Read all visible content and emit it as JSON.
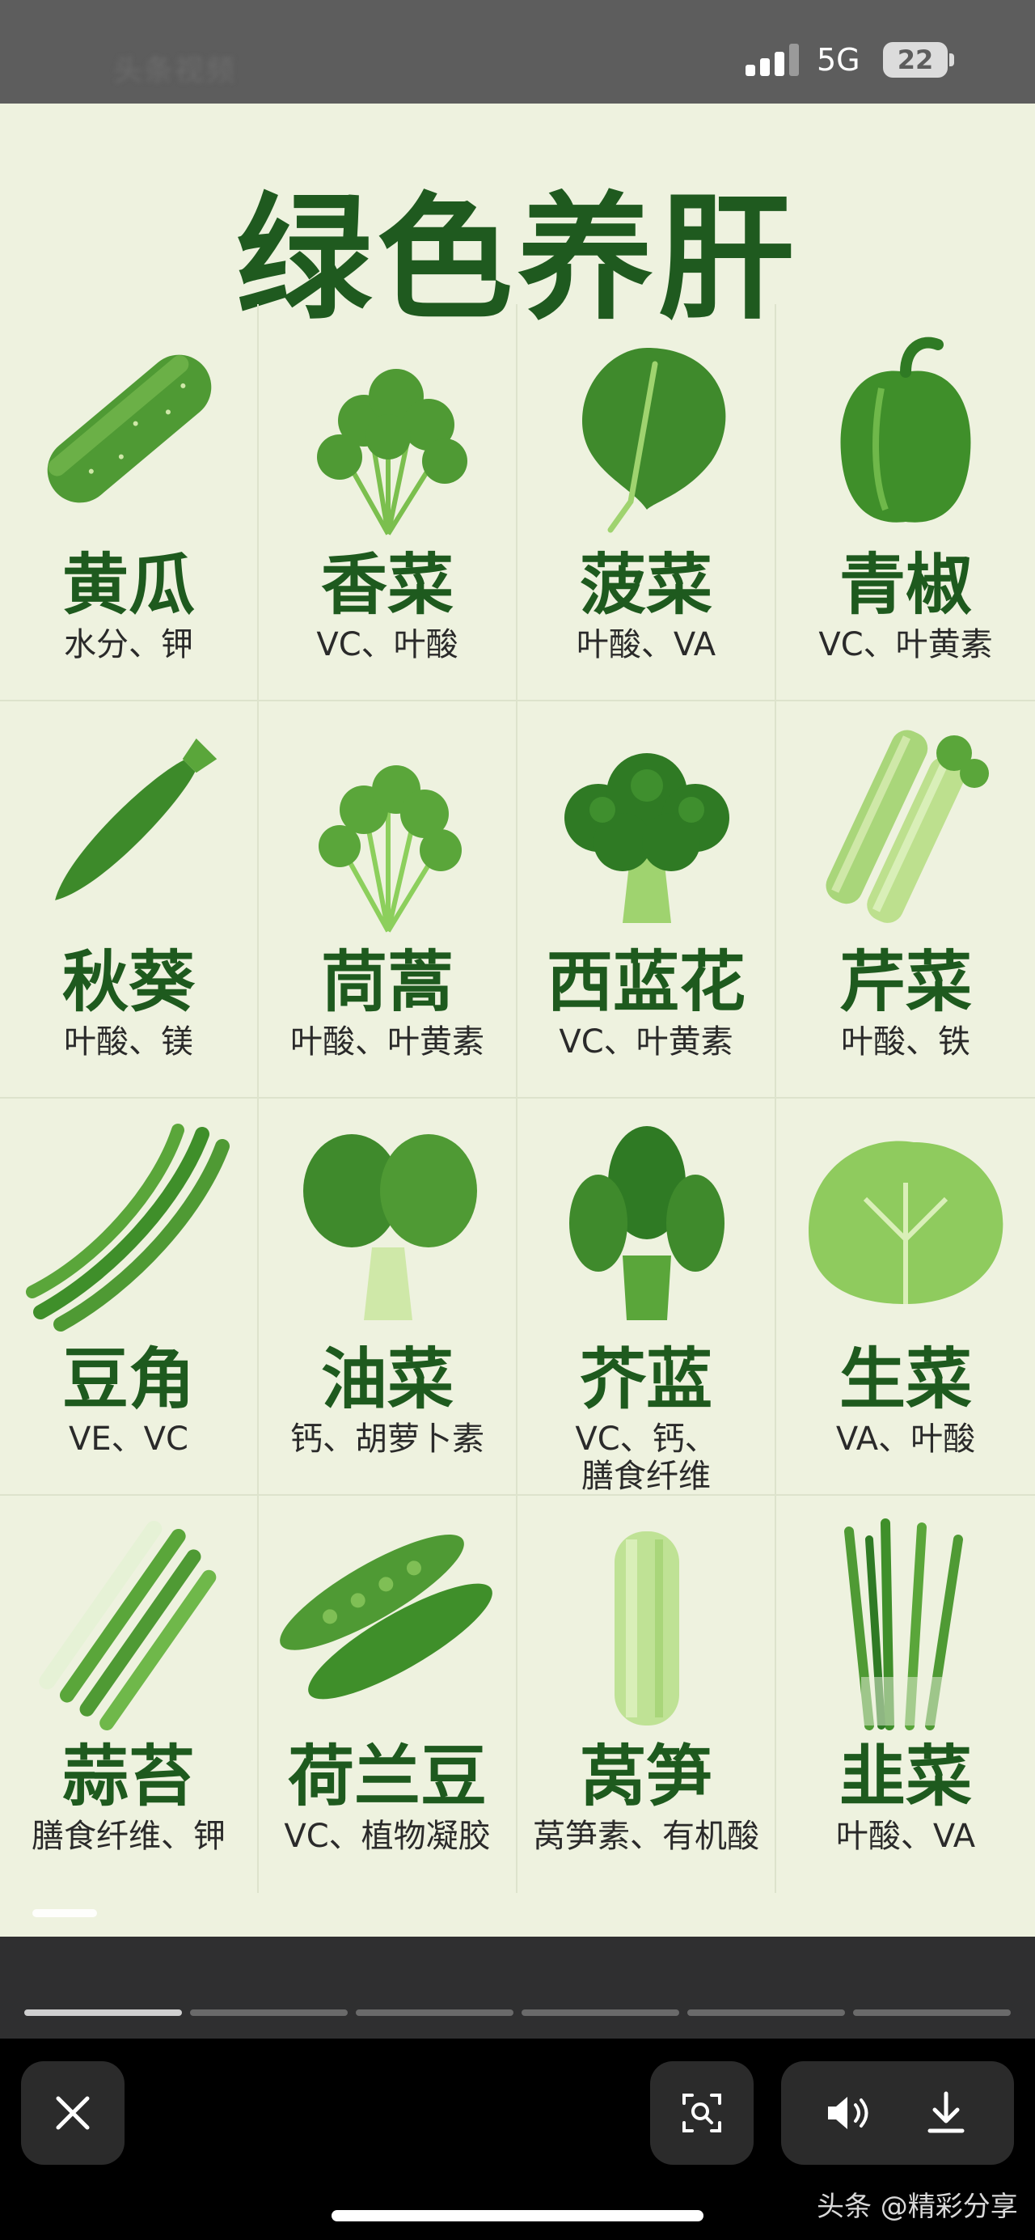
{
  "status_bar": {
    "app_hint": "头条视频",
    "network": "5G",
    "battery": "22"
  },
  "poster": {
    "title": "绿色养肝",
    "vegetables": [
      {
        "name": "黄瓜",
        "desc": "水分、钾",
        "icon": "cucumber-icon"
      },
      {
        "name": "香菜",
        "desc": "VC、叶酸",
        "icon": "coriander-icon"
      },
      {
        "name": "菠菜",
        "desc": "叶酸、VA",
        "icon": "spinach-icon"
      },
      {
        "name": "青椒",
        "desc": "VC、叶黄素",
        "icon": "green-pepper-icon"
      },
      {
        "name": "秋葵",
        "desc": "叶酸、镁",
        "icon": "okra-icon"
      },
      {
        "name": "茼蒿",
        "desc": "叶酸、叶黄素",
        "icon": "crown-daisy-icon"
      },
      {
        "name": "西蓝花",
        "desc": "VC、叶黄素",
        "icon": "broccoli-icon"
      },
      {
        "name": "芹菜",
        "desc": "叶酸、铁",
        "icon": "celery-icon"
      },
      {
        "name": "豆角",
        "desc": "VE、VC",
        "icon": "green-beans-icon"
      },
      {
        "name": "油菜",
        "desc": "钙、胡萝卜素",
        "icon": "rapeseed-greens-icon"
      },
      {
        "name": "芥蓝",
        "desc": "VC、钙、\n膳食纤维",
        "icon": "chinese-kale-icon"
      },
      {
        "name": "生菜",
        "desc": "VA、叶酸",
        "icon": "lettuce-icon"
      },
      {
        "name": "蒜苔",
        "desc": "膳食纤维、钾",
        "icon": "garlic-scape-icon"
      },
      {
        "name": "荷兰豆",
        "desc": "VC、植物凝胶",
        "icon": "snow-pea-icon"
      },
      {
        "name": "莴笋",
        "desc": "莴笋素、有机酸",
        "icon": "celtuce-icon"
      },
      {
        "name": "韭菜",
        "desc": "叶酸、VA",
        "icon": "chives-icon"
      }
    ]
  },
  "viewer": {
    "progress_segments": 6,
    "active_segment": 0,
    "close_icon": "close-icon",
    "scan_icon": "image-search-icon",
    "sound_icon": "speaker-icon",
    "download_icon": "download-icon",
    "brand_text": "头条 @精彩分享"
  },
  "colors": {
    "title_green": "#1f5a1f",
    "poster_bg": "#eef2df",
    "veg_green": "#5aa63a",
    "veg_dark": "#2f7a24",
    "veg_light": "#a9d67a"
  }
}
